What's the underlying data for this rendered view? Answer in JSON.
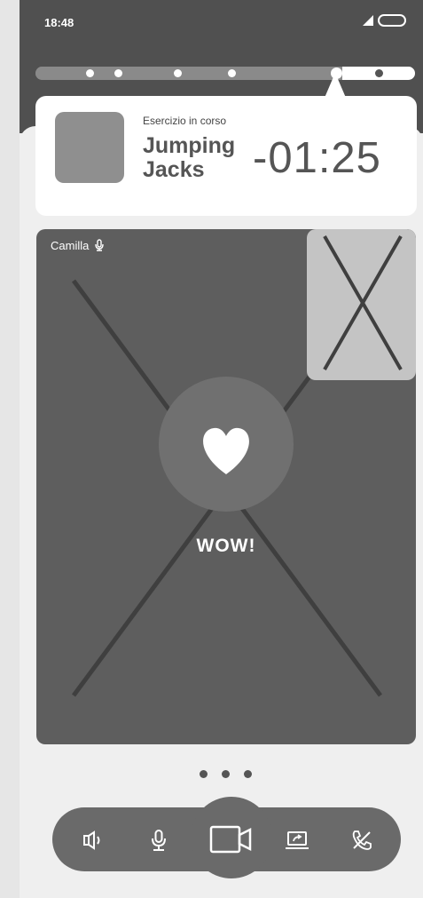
{
  "status": {
    "time": "18:48",
    "signal_icon": "signal-icon",
    "battery_icon": "battery-icon"
  },
  "progress": {
    "steps_total": 6,
    "current_step": 5
  },
  "exercise": {
    "label": "Esercizio in corso",
    "name": "Jumping Jacks",
    "timer": "-01:25"
  },
  "video": {
    "participant": "Camilla",
    "mic_icon": "microphone-icon",
    "reaction_icon": "heart-icon",
    "reaction_text": "WOW!"
  },
  "pager": {
    "count": 3
  },
  "controls": [
    "speaker-icon",
    "microphone-icon",
    "camera-icon",
    "screen-share-icon",
    "end-call-icon"
  ],
  "colors": {
    "dark": "#505050",
    "card": "#ffffff",
    "video": "#5e5e5e",
    "pip": "#c4c4c4",
    "bar": "#6a6a6a"
  }
}
